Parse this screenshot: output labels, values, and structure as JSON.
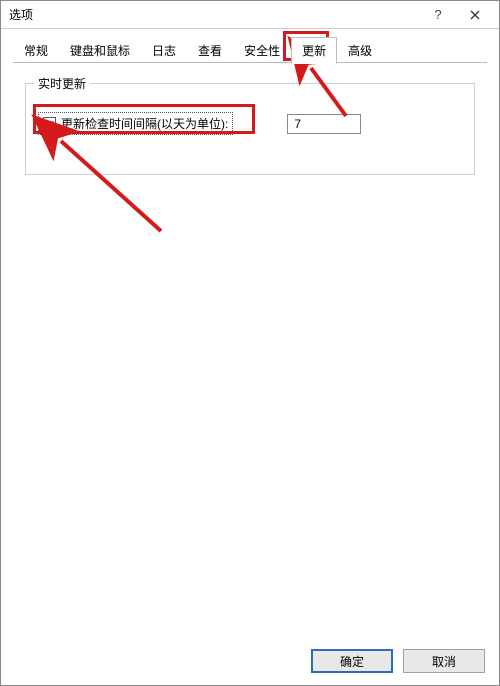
{
  "window": {
    "title": "选项"
  },
  "titlebar": {
    "help": "?",
    "close": "×"
  },
  "tabs": [
    {
      "id": "general",
      "label": "常规"
    },
    {
      "id": "keyboard",
      "label": "键盘和鼠标"
    },
    {
      "id": "log",
      "label": "日志"
    },
    {
      "id": "view",
      "label": "查看"
    },
    {
      "id": "security",
      "label": "安全性"
    },
    {
      "id": "update",
      "label": "更新",
      "active": true
    },
    {
      "id": "advanced",
      "label": "高级"
    }
  ],
  "group": {
    "legend": "实时更新",
    "checkbox_label": "更新检查时间间隔(以天为单位):",
    "checkbox_checked": true,
    "interval_value": "7"
  },
  "buttons": {
    "ok": "确定",
    "cancel": "取消"
  }
}
